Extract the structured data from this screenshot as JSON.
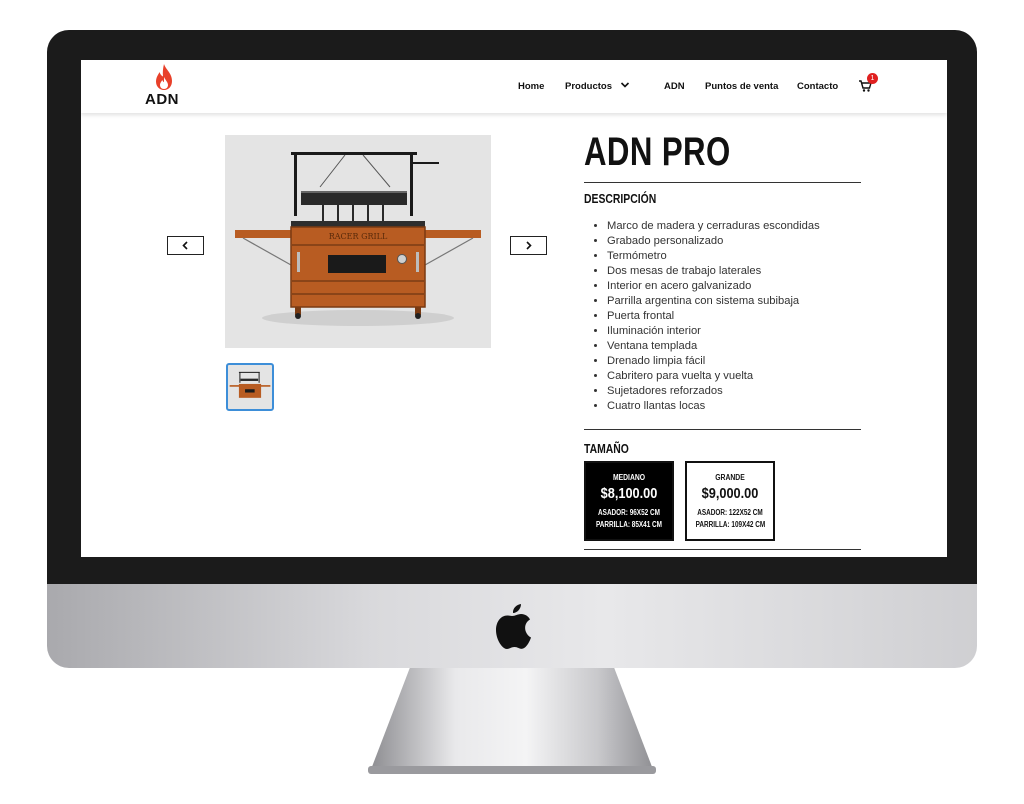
{
  "nav": {
    "logo_text": "ADN",
    "items": [
      "Home",
      "Productos",
      "ADN",
      "Puntos de venta",
      "Contacto"
    ],
    "cart_count": "1"
  },
  "product": {
    "title": "ADN PRO",
    "description_label": "DESCRIPCIÓN",
    "grill_brand_text": "RACER GRILL",
    "features": [
      "Marco de madera y cerraduras escondidas",
      "Grabado personalizado",
      "Termómetro",
      "Dos mesas de trabajo laterales",
      "Interior en acero galvanizado",
      "Parrilla argentina con sistema subibaja",
      "Puerta frontal",
      "Iluminación interior",
      "Ventana templada",
      "Drenado limpia fácil",
      "Cabritero para vuelta y vuelta",
      "Sujetadores reforzados",
      "Cuatro llantas locas"
    ],
    "size_label": "TAMAÑO",
    "sizes": [
      {
        "name": "MEDIANO",
        "price": "$8,100.00",
        "asador": "ASADOR: 96X52 CM",
        "parrilla": "PARRILLA: 85X41 CM",
        "selected": true
      },
      {
        "name": "GRANDE",
        "price": "$9,000.00",
        "asador": "ASADOR: 122X52 CM",
        "parrilla": "PARRILLA: 109X42 CM",
        "selected": false
      }
    ]
  },
  "icons": {
    "logo": "flame-icon",
    "prev": "chevron-left-icon",
    "next": "chevron-right-icon",
    "cart": "cart-icon",
    "dropdown": "chevron-down-icon",
    "device": "apple-logo-icon"
  },
  "colors": {
    "flame": "#e8402a",
    "badge": "#e02020",
    "thumb_border": "#3d8ed8",
    "wood": "#b85c22"
  }
}
